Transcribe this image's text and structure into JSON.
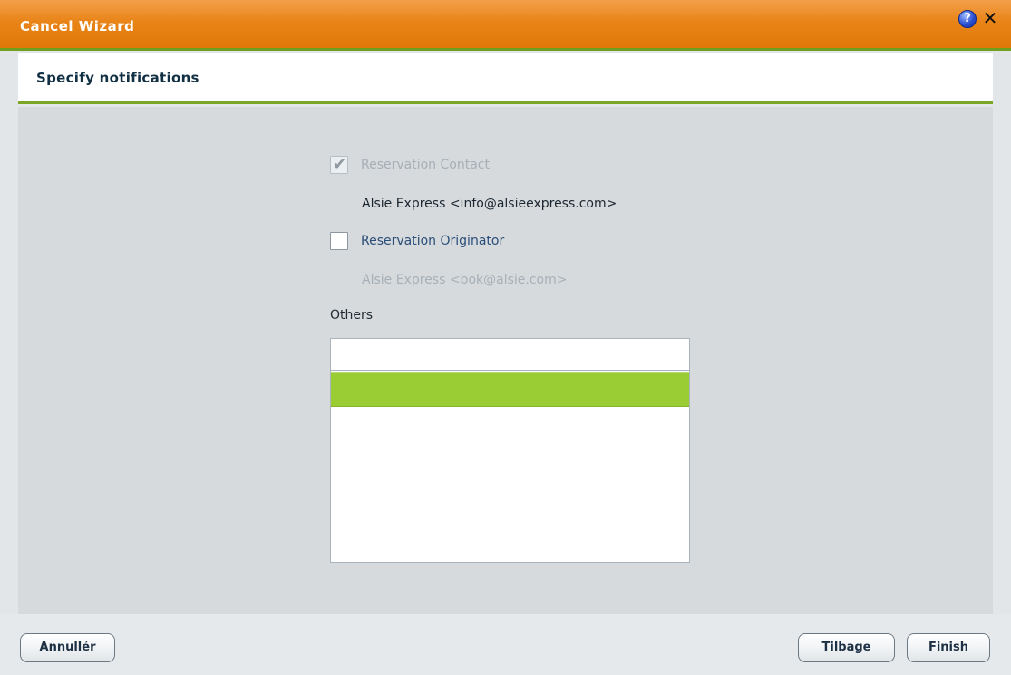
{
  "window": {
    "title": "Cancel Wizard",
    "help_glyph": "?",
    "close_glyph": "✕",
    "icons": [
      "help-icon",
      "close-icon"
    ]
  },
  "header": {
    "title": "Specify notifications"
  },
  "notifications": {
    "reservation_contact": {
      "label": "Reservation Contact",
      "checked": true,
      "disabled": true,
      "email": "Alsie Express <info@alsieexpress.com>"
    },
    "reservation_originator": {
      "label": "Reservation Originator",
      "checked": false,
      "disabled": false,
      "email": "Alsie Express <bok@alsie.com>"
    }
  },
  "others": {
    "label": "Others",
    "input_value": "",
    "selected_row_value": ""
  },
  "footer": {
    "cancel_label": "Annullér",
    "back_label": "Tilbage",
    "finish_label": "Finish"
  },
  "colors": {
    "titlebar": "#e98417",
    "accent_green": "#7ca625",
    "selection_green": "#9acd34",
    "content_bg": "#d6dadd"
  }
}
